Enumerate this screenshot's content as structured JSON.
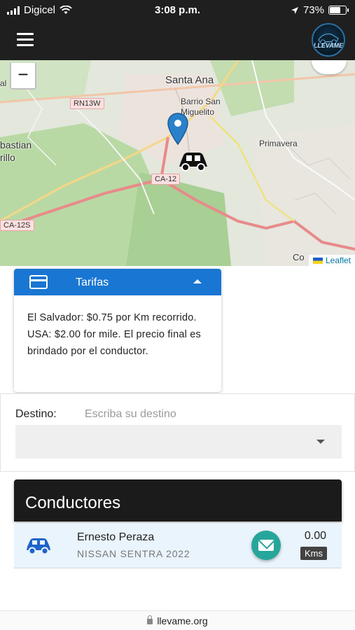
{
  "status_bar": {
    "carrier": "Digicel",
    "time": "3:08 p.m.",
    "battery_percent": "73%",
    "battery_level": 0.73
  },
  "app_bar": {
    "logo_text": "LLEVAME",
    "menu_icon": "hamburger-menu-icon"
  },
  "map": {
    "zoom_out_label": "−",
    "places": {
      "santa_ana": "Santa Ana",
      "barrio_san_miguelito": "Barrio San Miguelito",
      "primavera": "Primavera",
      "sebastian_rillo": "bastian rillo",
      "al": "al",
      "co": "Co"
    },
    "roads": {
      "rn13w": "RN13W",
      "ca12": "CA-12",
      "ca12s": "CA-12S"
    },
    "attribution": "Leaflet",
    "marker_icon": "map-pin-icon",
    "car_icon": "car-icon"
  },
  "tarifas": {
    "title": "Tarifas",
    "icon": "credit-card-icon",
    "body": "El Salvador: $0.75 por Km recorrido. USA: $2.00 for mile. El precio final es brindado por el conductor."
  },
  "destino": {
    "label": "Destino:",
    "placeholder": "Escriba su destino",
    "value": "",
    "select_value": ""
  },
  "conductores": {
    "title": "Conductores",
    "drivers": [
      {
        "name": "Ernesto Peraza",
        "car": "NISSAN SENTRA 2022",
        "distance": "0.00",
        "unit": "Kms",
        "icon": "car-icon",
        "action_icon": "mail-icon"
      }
    ]
  },
  "browser": {
    "url": "llevame.org"
  },
  "colors": {
    "header_bg": "#1f1f1f",
    "accent_blue": "#1976d2",
    "teal": "#26a69a",
    "driver_row_bg": "#eaf4fc"
  }
}
